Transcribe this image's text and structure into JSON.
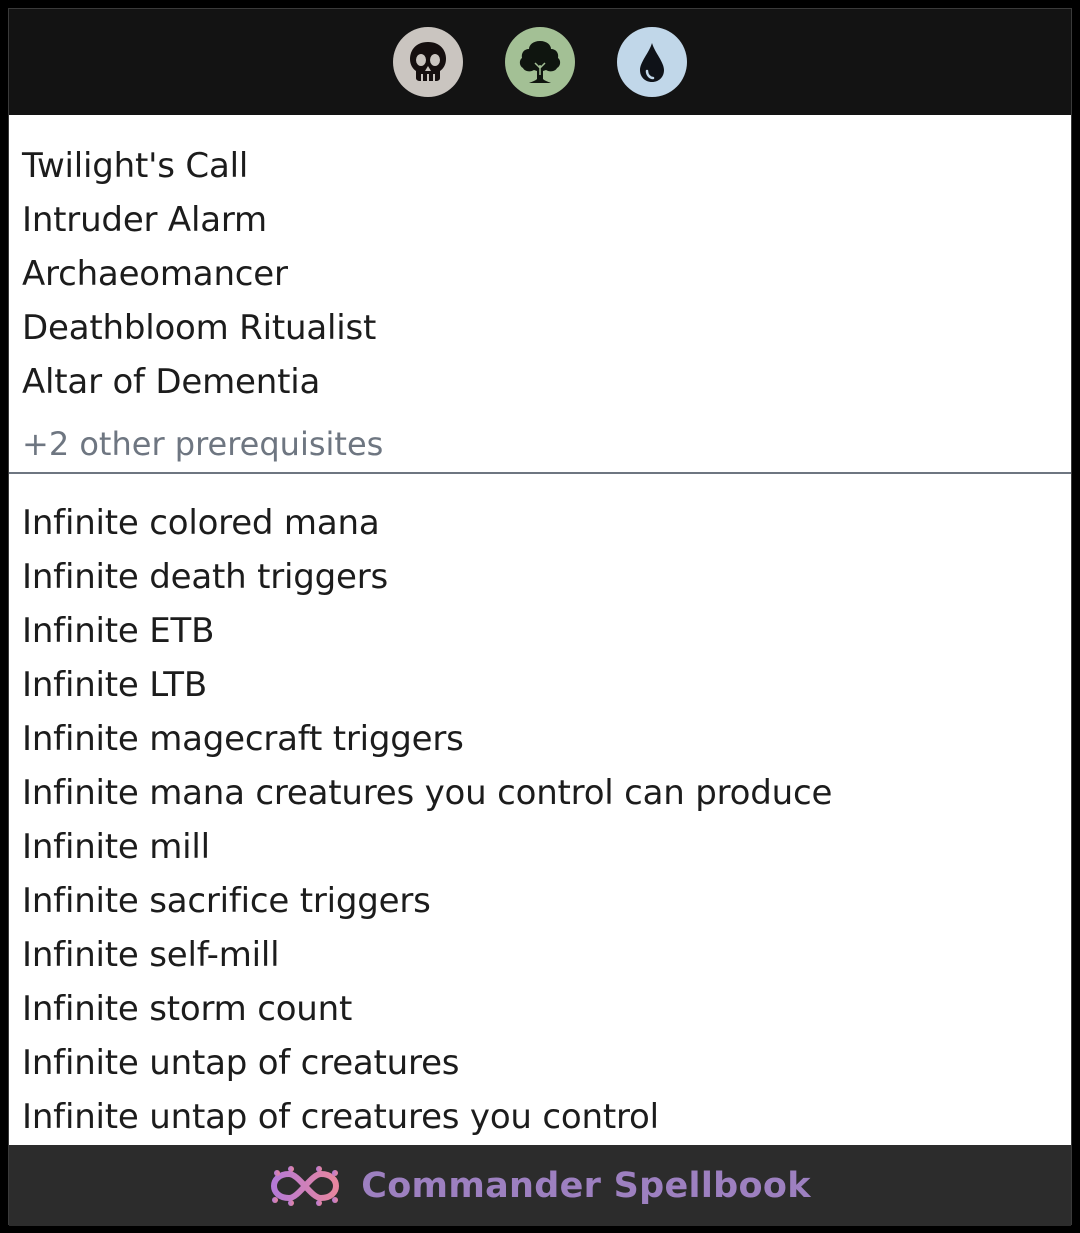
{
  "header": {
    "mana_symbols": [
      {
        "icon": "black-mana-skull-icon",
        "color": "#cac5c0"
      },
      {
        "icon": "green-mana-tree-icon",
        "color": "#a3c095"
      },
      {
        "icon": "blue-mana-drop-icon",
        "color": "#c1d7e9"
      }
    ]
  },
  "cards": [
    "Twilight's Call",
    "Intruder Alarm",
    "Archaeomancer",
    "Deathbloom Ritualist",
    "Altar of Dementia"
  ],
  "other_prerequisites": "+2 other prerequisites",
  "results": [
    "Infinite colored mana",
    "Infinite death triggers",
    "Infinite ETB",
    "Infinite LTB",
    "Infinite magecraft triggers",
    "Infinite mana creatures you control can produce",
    "Infinite mill",
    "Infinite sacrifice triggers",
    "Infinite self-mill",
    "Infinite storm count",
    "Infinite untap of creatures",
    "Infinite untap of creatures you control"
  ],
  "footer": {
    "brand": "Commander Spellbook",
    "logo_icon": "infinity-logo-icon",
    "brand_color": "#9d80c0"
  }
}
